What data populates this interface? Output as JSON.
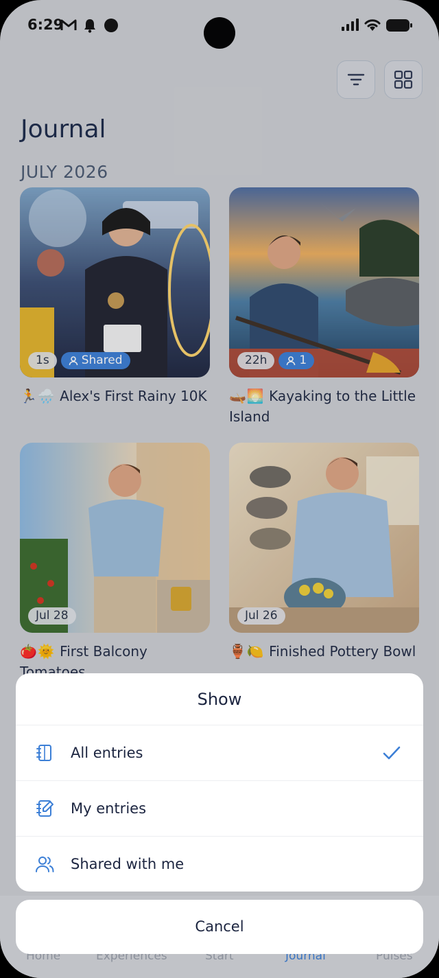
{
  "status_bar": {
    "time": "6:29"
  },
  "header": {
    "title": "Journal",
    "filter_icon": "filter-lines-icon",
    "grid_icon": "grid-view-icon"
  },
  "month": "JULY 2026",
  "entries": [
    {
      "emoji": "🏃🌧️",
      "title": "Alex's First Rainy 10K",
      "time_badge": "1s",
      "share_badge": "Shared"
    },
    {
      "emoji": "🛶🌅",
      "title": "Kayaking to the Little Island",
      "time_badge": "22h",
      "share_badge": "1"
    },
    {
      "emoji": "🍅🌞",
      "title": "First Balcony Tomatoes",
      "time_badge": "Jul 28"
    },
    {
      "emoji": "🏺🍋",
      "title": "Finished Pottery Bowl",
      "time_badge": "Jul 26"
    }
  ],
  "bottom_nav": {
    "items": [
      "Home",
      "Experiences",
      "Start",
      "Journal",
      "Pulses"
    ],
    "active": "Journal"
  },
  "sheet": {
    "title": "Show",
    "options": [
      {
        "label": "All entries",
        "icon": "notebook-icon",
        "selected": true
      },
      {
        "label": "My entries",
        "icon": "edit-notebook-icon",
        "selected": false
      },
      {
        "label": "Shared with me",
        "icon": "users-icon",
        "selected": false
      }
    ],
    "cancel_label": "Cancel"
  },
  "colors": {
    "accent": "#3c7fd6",
    "text": "#1c2540",
    "background": "#d0d2d6"
  }
}
